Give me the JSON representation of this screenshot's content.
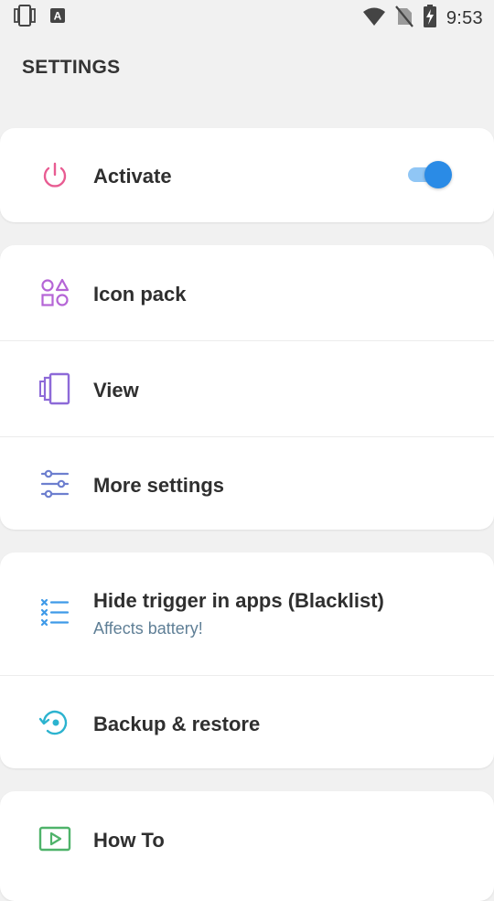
{
  "status_bar": {
    "time": "9:53",
    "icons": [
      "phone-frame-icon",
      "keyboard-a-icon",
      "wifi-icon",
      "no-sim-icon",
      "battery-charging-icon"
    ]
  },
  "page": {
    "title": "SETTINGS"
  },
  "cards": {
    "activate": {
      "label": "Activate",
      "icon": "power-icon",
      "icon_color": "#e85c92",
      "toggle_on": true,
      "toggle_color": "#2a8be6"
    },
    "appearance": {
      "items": [
        {
          "label": "Icon pack",
          "icon": "shapes-icon",
          "icon_color": "#b565d6"
        },
        {
          "label": "View",
          "icon": "layers-view-icon",
          "icon_color": "#8d6ad8"
        },
        {
          "label": "More settings",
          "icon": "sliders-icon",
          "icon_color": "#6d7fcf"
        }
      ]
    },
    "tools": {
      "items": [
        {
          "label": "Hide trigger in apps (Blacklist)",
          "sublabel": "Affects battery!",
          "icon": "blacklist-icon",
          "icon_color": "#3f9ae8"
        },
        {
          "label": "Backup & restore",
          "icon": "backup-restore-icon",
          "icon_color": "#2cb3cf"
        }
      ]
    },
    "help": {
      "items": [
        {
          "label": "How To",
          "icon": "play-video-icon",
          "icon_color": "#4fb36a"
        }
      ]
    }
  }
}
